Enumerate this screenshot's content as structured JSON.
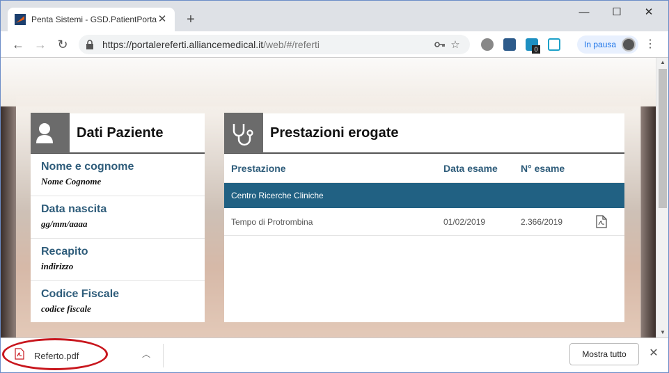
{
  "browser": {
    "tab_title": "Penta Sistemi - GSD.PatientPortal",
    "url_host": "https://portalereferti.alliancemedical.it",
    "url_path": "/web/#/referti",
    "profile_status": "In pausa",
    "extension_badge": "0"
  },
  "patient_panel": {
    "title": "Dati Paziente",
    "fields": [
      {
        "label": "Nome e cognome",
        "value": "Nome Cognome"
      },
      {
        "label": "Data nascita",
        "value": "gg/mm/aaaa"
      },
      {
        "label": "Recapito",
        "value": "indirizzo"
      },
      {
        "label": "Codice Fiscale",
        "value": "codice fiscale"
      }
    ]
  },
  "exams_panel": {
    "title": "Prestazioni erogate",
    "columns": [
      "Prestazione",
      "Data esame",
      "N° esame"
    ],
    "group": "Centro Ricerche Cliniche",
    "rows": [
      {
        "prestazione": "Tempo di Protrombina",
        "data": "01/02/2019",
        "numero": "2.366/2019",
        "icon": "pdf-icon"
      }
    ]
  },
  "download_bar": {
    "file_name": "Referto.pdf",
    "show_all_label": "Mostra tutto"
  },
  "colors": {
    "accent": "#216183",
    "label": "#2e5c7a",
    "highlight_circle": "#c8161d"
  }
}
